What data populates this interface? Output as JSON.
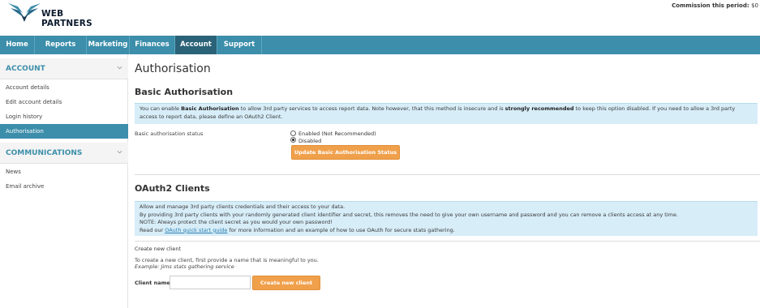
{
  "brand": {
    "name": "WEB PARTNERS"
  },
  "header": {
    "commission_label": "Commission this period:",
    "commission_value": "$0"
  },
  "nav": {
    "items": [
      {
        "label": "Home"
      },
      {
        "label": "Reports"
      },
      {
        "label": "Marketing"
      },
      {
        "label": "Finances"
      },
      {
        "label": "Account"
      },
      {
        "label": "Support"
      }
    ],
    "active": "Account"
  },
  "sidebar": {
    "account_heading": "ACCOUNT",
    "account_items": [
      {
        "label": "Account details"
      },
      {
        "label": "Edit account details"
      },
      {
        "label": "Login history"
      },
      {
        "label": "Authorisation"
      }
    ],
    "communications_heading": "COMMUNICATIONS",
    "communications_items": [
      {
        "label": "News"
      },
      {
        "label": "Email archive"
      }
    ]
  },
  "page": {
    "title": "Authorisation",
    "basic": {
      "heading": "Basic Authorisation",
      "info_1": "You can enable ",
      "info_bold_1": "Basic Authorisation",
      "info_2": " to allow 3rd party services to access report data. Note however, that this method is insecure and is ",
      "info_bold_2": "strongly recommended",
      "info_3": " to keep this option disabled. If you need to allow a 3rd party access to report data, please define an OAuth2 Client.",
      "status_label": "Basic authorisation status",
      "option_enabled": "Enabled (Not Recommended)",
      "option_disabled": "Disabled",
      "selected": "Disabled",
      "update_button": "Update Basic Authorisation Status"
    },
    "oauth": {
      "heading": "OAuth2 Clients",
      "info_line1": "Allow and manage 3rd party clients credentials and their access to your data.",
      "info_line2": "By providing 3rd party clients with your randomly generated client identifier and secret, this removes the need to give your own username and password and you can remove a clients access at any time.",
      "info_line3": "NOTE: Always protect the client secret as you would your own password!",
      "info_line4_pre": "Read our ",
      "info_link": "OAuth quick start guide",
      "info_line4_post": " for more information and an example of how to use OAuth for secure stats gathering.",
      "create_heading": "Create new client",
      "create_desc": "To create a new client, first provide a name that is meaningful to you.",
      "create_example": "Example: Jims stats gathering service",
      "client_name_label": "Client name:",
      "client_name_value": "",
      "create_button": "Create new client"
    }
  },
  "colors": {
    "nav": "#3c8eaa",
    "nav_active": "#2a6277",
    "accent_button": "#f0a04b",
    "info_bg": "#d7edf8"
  }
}
